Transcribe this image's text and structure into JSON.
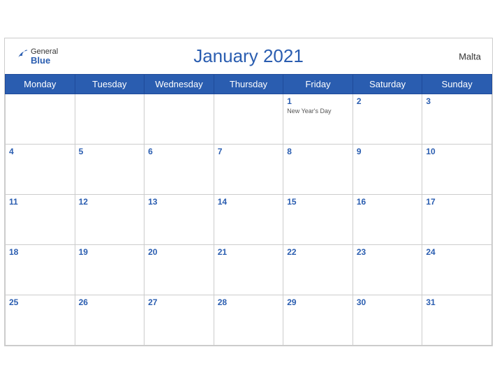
{
  "header": {
    "brand_general": "General",
    "brand_blue": "Blue",
    "title": "January 2021",
    "country": "Malta"
  },
  "weekdays": [
    "Monday",
    "Tuesday",
    "Wednesday",
    "Thursday",
    "Friday",
    "Saturday",
    "Sunday"
  ],
  "weeks": [
    [
      {
        "day": "",
        "empty": true
      },
      {
        "day": "",
        "empty": true
      },
      {
        "day": "",
        "empty": true
      },
      {
        "day": "",
        "empty": true
      },
      {
        "day": "1",
        "holiday": "New Year's Day"
      },
      {
        "day": "2"
      },
      {
        "day": "3"
      }
    ],
    [
      {
        "day": "4"
      },
      {
        "day": "5"
      },
      {
        "day": "6"
      },
      {
        "day": "7"
      },
      {
        "day": "8"
      },
      {
        "day": "9"
      },
      {
        "day": "10"
      }
    ],
    [
      {
        "day": "11"
      },
      {
        "day": "12"
      },
      {
        "day": "13"
      },
      {
        "day": "14"
      },
      {
        "day": "15"
      },
      {
        "day": "16"
      },
      {
        "day": "17"
      }
    ],
    [
      {
        "day": "18"
      },
      {
        "day": "19"
      },
      {
        "day": "20"
      },
      {
        "day": "21"
      },
      {
        "day": "22"
      },
      {
        "day": "23"
      },
      {
        "day": "24"
      }
    ],
    [
      {
        "day": "25"
      },
      {
        "day": "26"
      },
      {
        "day": "27"
      },
      {
        "day": "28"
      },
      {
        "day": "29"
      },
      {
        "day": "30"
      },
      {
        "day": "31"
      }
    ]
  ],
  "colors": {
    "blue": "#2a5db0",
    "white": "#ffffff",
    "light_gray": "#cccccc",
    "text_dark": "#333333"
  }
}
